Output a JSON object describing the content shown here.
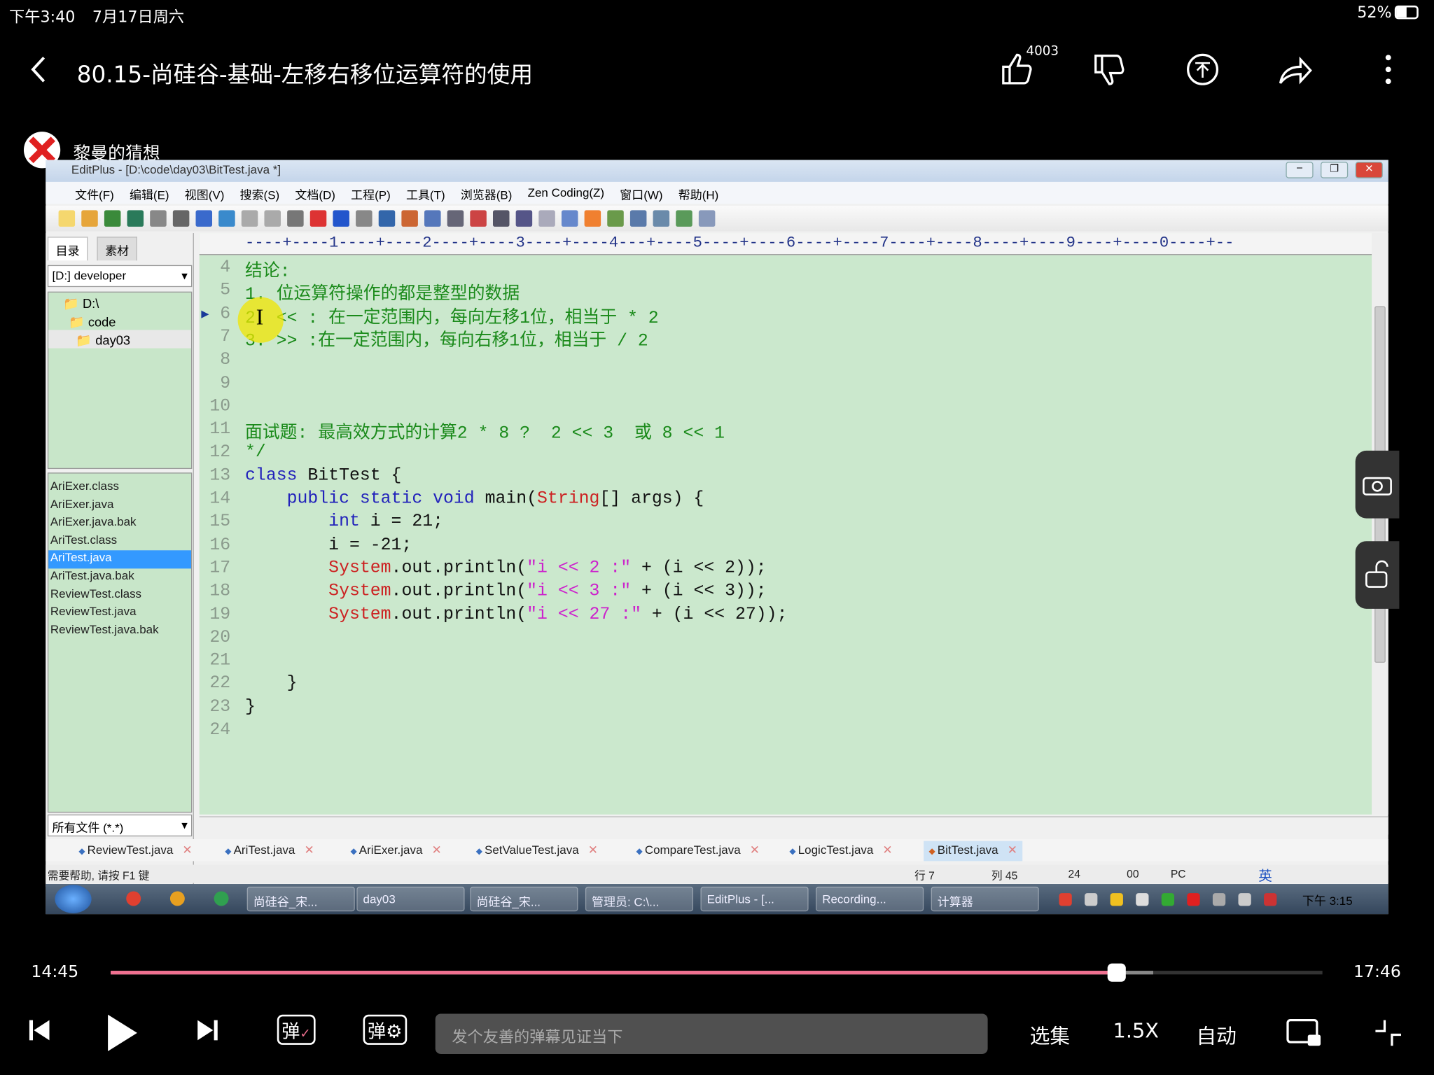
{
  "status_bar": {
    "time": "下午3:40",
    "date": "7月17日周六",
    "battery": "52%"
  },
  "header": {
    "title": "80.15-尚硅谷-基础-左移右移位运算符的使用",
    "like_count": "4003",
    "icons": [
      "back-icon",
      "thumbs-up-icon",
      "thumbs-down-icon",
      "coin-icon",
      "share-icon",
      "more-icon"
    ]
  },
  "uploader": {
    "name": "黎曼的猜想"
  },
  "editplus": {
    "title": "EditPlus - [D:\\code\\day03\\BitTest.java *]",
    "menu": [
      "文件(F)",
      "编辑(E)",
      "视图(V)",
      "搜索(S)",
      "文档(D)",
      "工程(P)",
      "工具(T)",
      "浏览器(B)",
      "Zen Coding(Z)",
      "窗口(W)",
      "帮助(H)"
    ],
    "left_tabs": [
      "目录",
      "素材"
    ],
    "drive": "[D:] developer",
    "tree": [
      "D:\\",
      "code",
      "day03"
    ],
    "files": [
      "AriExer.class",
      "AriExer.java",
      "AriExer.java.bak",
      "AriTest.class",
      "AriTest.java",
      "AriTest.java.bak",
      "ReviewTest.class",
      "ReviewTest.java",
      "ReviewTest.java.bak"
    ],
    "selected_file": "AriTest.java",
    "filter": "所有文件 (*.*)",
    "ruler": "----+----1----+----2----+----3----+----4---+----5----+----6----+----7----+----8----+----9----+----0----+--",
    "lines": [
      {
        "n": "4",
        "segs": [
          {
            "t": "结论:",
            "c": "comment"
          }
        ]
      },
      {
        "n": "5",
        "segs": [
          {
            "t": "1. 位运算符操作的都是整型的数据",
            "c": "comment"
          }
        ]
      },
      {
        "n": "6",
        "segs": [
          {
            "t": "2. << : 在一定范围内，每向左移1位，相当于 * 2",
            "c": "comment"
          }
        ]
      },
      {
        "n": "7",
        "segs": [
          {
            "t": "3. >> :在一定范围内，每向右移1位，相当于 / 2",
            "c": "comment"
          }
        ]
      },
      {
        "n": "8",
        "segs": []
      },
      {
        "n": "9",
        "segs": []
      },
      {
        "n": "10",
        "segs": []
      },
      {
        "n": "11",
        "segs": [
          {
            "t": "面试题: 最高效方式的计算2 * 8 ?  2 << 3  或 8 << 1",
            "c": "comment"
          }
        ]
      },
      {
        "n": "12",
        "segs": [
          {
            "t": "*/",
            "c": "comment"
          }
        ]
      },
      {
        "n": "13",
        "segs": [
          {
            "t": "class",
            "c": "kw"
          },
          {
            "t": " BitTest {",
            "c": "plain"
          }
        ]
      },
      {
        "n": "14",
        "segs": [
          {
            "t": "    public static void",
            "c": "kw"
          },
          {
            "t": " main(",
            "c": "plain"
          },
          {
            "t": "String",
            "c": "type"
          },
          {
            "t": "[] args) {",
            "c": "plain"
          }
        ]
      },
      {
        "n": "15",
        "segs": [
          {
            "t": "        int",
            "c": "kw"
          },
          {
            "t": " i = 21;",
            "c": "plain"
          }
        ]
      },
      {
        "n": "16",
        "segs": [
          {
            "t": "        i = -21;",
            "c": "plain"
          }
        ]
      },
      {
        "n": "17",
        "segs": [
          {
            "t": "        System",
            "c": "type"
          },
          {
            "t": ".out.println(",
            "c": "plain"
          },
          {
            "t": "\"i << 2 :\"",
            "c": "str"
          },
          {
            "t": " + (i << 2));",
            "c": "plain"
          }
        ]
      },
      {
        "n": "18",
        "segs": [
          {
            "t": "        System",
            "c": "type"
          },
          {
            "t": ".out.println(",
            "c": "plain"
          },
          {
            "t": "\"i << 3 :\"",
            "c": "str"
          },
          {
            "t": " + (i << 3));",
            "c": "plain"
          }
        ]
      },
      {
        "n": "19",
        "segs": [
          {
            "t": "        System",
            "c": "type"
          },
          {
            "t": ".out.println(",
            "c": "plain"
          },
          {
            "t": "\"i << 27 :\"",
            "c": "str"
          },
          {
            "t": " + (i << 27));",
            "c": "plain"
          }
        ]
      },
      {
        "n": "20",
        "segs": []
      },
      {
        "n": "21",
        "segs": []
      },
      {
        "n": "22",
        "segs": [
          {
            "t": "    }",
            "c": "plain"
          }
        ]
      },
      {
        "n": "23",
        "segs": [
          {
            "t": "}",
            "c": "plain"
          }
        ]
      },
      {
        "n": "24",
        "segs": []
      }
    ],
    "file_tabs": [
      "ReviewTest.java",
      "AriTest.java",
      "AriExer.java",
      "SetValueTest.java",
      "CompareTest.java",
      "LogicTest.java",
      "BitTest.java"
    ],
    "active_tab": "BitTest.java",
    "status": {
      "help": "需要帮助, 请按 F1 键",
      "row": "行 7",
      "col": "列 45",
      "n1": "24",
      "n2": "00",
      "mode": "PC",
      "ime": "英"
    },
    "taskbar": [
      "尚硅谷_宋...",
      "day03",
      "尚硅谷_宋...",
      "管理员: C:\\...",
      "EditPlus - [...",
      "Recording...",
      "计算器"
    ],
    "clock": "下午 3:15"
  },
  "player": {
    "current": "14:45",
    "total": "17:46",
    "progress": 0.83,
    "buffered": 0.86,
    "danmaku_placeholder": "发个友善的弹幕见证当下",
    "episodes": "选集",
    "speed": "1.5X",
    "quality": "自动"
  },
  "colors": {
    "progress": "#f07090",
    "editor_bg": "#cbe8cd",
    "comment": "#1a8a1a"
  }
}
